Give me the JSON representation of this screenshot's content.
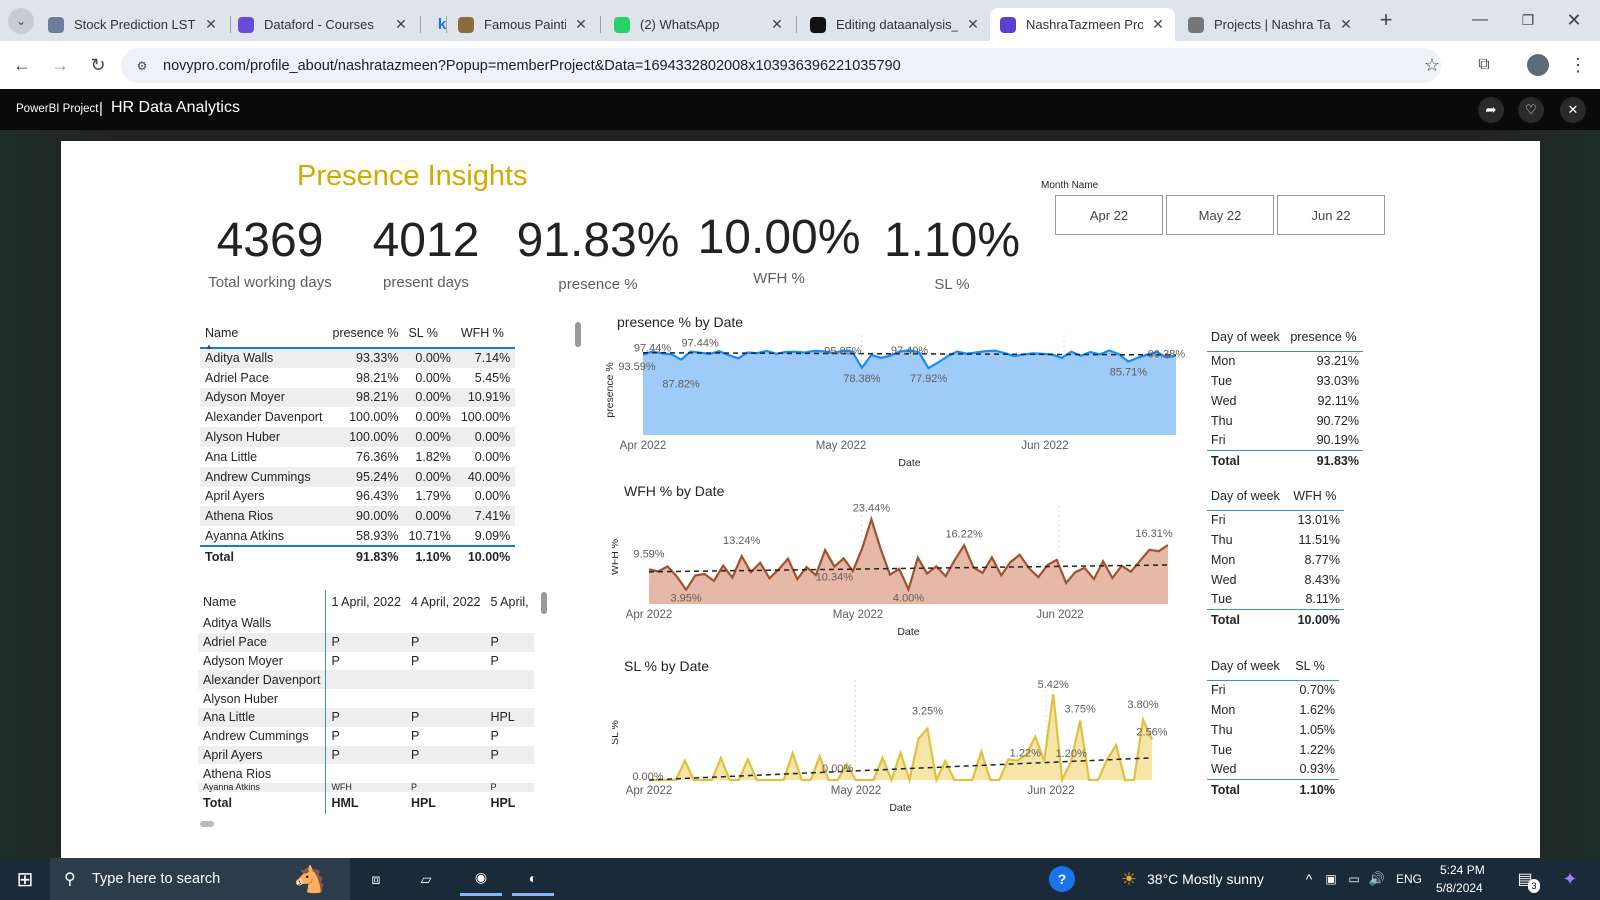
{
  "browser": {
    "tabs": [
      {
        "title": "Stock Prediction LSTM",
        "fav": "notebook-icon",
        "color": "#6b7f9a"
      },
      {
        "title": "Dataford - Courses",
        "fav": "dataford-icon",
        "color": "#6a4bd8"
      },
      {
        "title": "k",
        "fav": "k-icon",
        "color": "#1a73e8"
      },
      {
        "title": "Famous Paintings",
        "fav": "painting-icon",
        "color": "#8c6b3f"
      },
      {
        "title": "(2) WhatsApp",
        "fav": "whatsapp-icon",
        "color": "#25d366"
      },
      {
        "title": "Editing dataanalysis_",
        "fav": "github-icon",
        "color": "#111111"
      },
      {
        "title": "NashraTazmeen Proje",
        "fav": "novypro-icon",
        "color": "#5b3fd1"
      },
      {
        "title": "Projects | Nashra Taz",
        "fav": "globe-icon",
        "color": "#777777"
      }
    ],
    "new_tab": "+",
    "url": "novypro.com/profile_about/nashratazmeen?Popup=memberProject&Data=1694332802008x103936396221035790"
  },
  "header": {
    "prefix": "PowerBI Project",
    "separator": "|",
    "title": "HR Data Analytics"
  },
  "report": {
    "title": "Presence Insights",
    "kpis": [
      {
        "value": "4369",
        "label": "Total working days"
      },
      {
        "value": "4012",
        "label": "present days"
      },
      {
        "value": "91.83%",
        "label": "presence %"
      },
      {
        "value": "10.00%",
        "label": "WFH %"
      },
      {
        "value": "1.10%",
        "label": "SL %"
      }
    ],
    "month_slicer": {
      "label": "Month Name",
      "options": [
        "Apr 22",
        "May 22",
        "Jun 22"
      ]
    },
    "emp_table": {
      "headers": [
        "Name",
        "presence %",
        "SL %",
        "WFH %"
      ],
      "rows": [
        [
          "Aditya Walls",
          "93.33%",
          "0.00%",
          "7.14%"
        ],
        [
          "Adriel Pace",
          "98.21%",
          "0.00%",
          "5.45%"
        ],
        [
          "Adyson Moyer",
          "98.21%",
          "0.00%",
          "10.91%"
        ],
        [
          "Alexander Davenport",
          "100.00%",
          "0.00%",
          "100.00%"
        ],
        [
          "Alyson Huber",
          "100.00%",
          "0.00%",
          "0.00%"
        ],
        [
          "Ana Little",
          "76.36%",
          "1.82%",
          "0.00%"
        ],
        [
          "Andrew Cummings",
          "95.24%",
          "0.00%",
          "40.00%"
        ],
        [
          "April Ayers",
          "96.43%",
          "1.79%",
          "0.00%"
        ],
        [
          "Athena Rios",
          "90.00%",
          "0.00%",
          "7.41%"
        ],
        [
          "Ayanna Atkins",
          "58.93%",
          "10.71%",
          "9.09%"
        ]
      ],
      "total": [
        "Total",
        "91.83%",
        "1.10%",
        "10.00%"
      ]
    },
    "attendance_table": {
      "headers": [
        "Name",
        "1 April, 2022",
        "4 April, 2022",
        "5 April,"
      ],
      "rows": [
        [
          "Aditya Walls",
          "",
          "",
          ""
        ],
        [
          "Adriel Pace",
          "P",
          "P",
          "P"
        ],
        [
          "Adyson Moyer",
          "P",
          "P",
          "P"
        ],
        [
          "Alexander Davenport",
          "",
          "",
          ""
        ],
        [
          "Alyson Huber",
          "",
          "",
          ""
        ],
        [
          "Ana Little",
          "P",
          "P",
          "HPL"
        ],
        [
          "Andrew Cummings",
          "P",
          "P",
          "P"
        ],
        [
          "April Ayers",
          "P",
          "P",
          "P"
        ],
        [
          "Athena Rios",
          "",
          "",
          ""
        ],
        [
          "Ayanna Atkins",
          "WFH",
          "P",
          "P"
        ]
      ],
      "total": [
        "Total",
        "HML",
        "HPL",
        "HPL"
      ]
    },
    "dow_presence": {
      "headers": [
        "Day of week",
        "presence %"
      ],
      "rows": [
        [
          "Mon",
          "93.21%"
        ],
        [
          "Tue",
          "93.03%"
        ],
        [
          "Wed",
          "92.11%"
        ],
        [
          "Thu",
          "90.72%"
        ],
        [
          "Fri",
          "90.19%"
        ]
      ],
      "total": [
        "Total",
        "91.83%"
      ]
    },
    "dow_wfh": {
      "headers": [
        "Day of week",
        "WFH %"
      ],
      "rows": [
        [
          "Fri",
          "13.01%"
        ],
        [
          "Thu",
          "11.51%"
        ],
        [
          "Mon",
          "8.77%"
        ],
        [
          "Wed",
          "8.43%"
        ],
        [
          "Tue",
          "8.11%"
        ]
      ],
      "total": [
        "Total",
        "10.00%"
      ]
    },
    "dow_sl": {
      "headers": [
        "Day of week",
        "SL %"
      ],
      "rows": [
        [
          "Fri",
          "0.70%"
        ],
        [
          "Mon",
          "1.62%"
        ],
        [
          "Thu",
          "1.05%"
        ],
        [
          "Tue",
          "1.22%"
        ],
        [
          "Wed",
          "0.93%"
        ]
      ],
      "total": [
        "Total",
        "1.10%"
      ]
    },
    "charts_titles": [
      "presence % by Date",
      "WFH % by Date",
      "SL % by Date"
    ]
  },
  "chart_data": [
    {
      "type": "area",
      "title": "presence % by Date",
      "xlabel": "Date",
      "ylabel": "presence %",
      "x_ticks": [
        "Apr 2022",
        "May 2022",
        "Jun 2022"
      ],
      "color": "#118dff",
      "fill": "#9ecbf7",
      "ylim": [
        0,
        105
      ],
      "values": [
        93.59,
        97.44,
        95.2,
        94.1,
        87.82,
        97.44,
        96.0,
        94.5,
        97.8,
        93.1,
        89.5,
        96.3,
        95.6,
        98.0,
        94.7,
        96.8,
        97.2,
        96.1,
        98.1,
        97.6,
        95.85,
        98.4,
        97.1,
        78.38,
        93.5,
        90.1,
        92.6,
        97.4,
        98.9,
        96.4,
        77.92,
        84.6,
        91.8,
        97.4,
        94.8,
        96.2,
        97.9,
        98.3,
        95.6,
        92.1,
        93.9,
        95.2,
        94.7,
        93.8,
        89.9,
        97.1,
        92.4,
        96.8,
        94.0,
        98.6,
        94.3,
        85.71,
        90.2,
        93.8,
        96.7,
        90.38,
        93.0
      ],
      "data_labels": [
        "93.59%",
        "97.44%",
        "87.82%",
        "97.44%",
        "95.85%",
        "78.38%",
        "97.40%",
        "77.92%",
        "85.71%",
        "90.38%"
      ],
      "trend": [
        96.0,
        93.4
      ]
    },
    {
      "type": "area",
      "title": "WFH % by Date",
      "xlabel": "Date",
      "ylabel": "WFH %",
      "x_ticks": [
        "Apr 2022",
        "May 2022",
        "Jun 2022"
      ],
      "color": "#a0522d",
      "fill": "#e6b8a8",
      "ylim": [
        0,
        26
      ],
      "values": [
        9.59,
        9.0,
        10.4,
        7.6,
        3.95,
        7.9,
        8.3,
        6.4,
        10.6,
        7.3,
        13.24,
        8.8,
        11.4,
        7.1,
        9.6,
        12.5,
        6.9,
        10.2,
        8.0,
        14.9,
        10.34,
        12.6,
        9.1,
        15.4,
        23.44,
        15.2,
        8.1,
        9.7,
        4.0,
        12.8,
        8.4,
        10.4,
        7.7,
        12.2,
        16.22,
        10.1,
        8.6,
        12.9,
        7.9,
        11.6,
        13.6,
        9.9,
        7.4,
        10.8,
        12.2,
        5.8,
        8.8,
        10.0,
        6.9,
        11.8,
        7.2,
        10.6,
        8.9,
        12.0,
        15.0,
        14.6,
        16.31
      ],
      "data_labels": [
        "9.59%",
        "3.95%",
        "13.24%",
        "10.34%",
        "23.44%",
        "4.00%",
        "16.22%",
        "16.31%"
      ],
      "trend": [
        8.9,
        10.8
      ]
    },
    {
      "type": "area",
      "title": "SL % by Date",
      "xlabel": "Date",
      "ylabel": "SL %",
      "x_ticks": [
        "Apr 2022",
        "May 2022",
        "Jun 2022"
      ],
      "color": "#e0c03d",
      "fill": "#f5e6a8",
      "ylim": [
        0,
        6
      ],
      "values": [
        0,
        0,
        0,
        0,
        1.22,
        0,
        0,
        0,
        1.4,
        0,
        0,
        1.3,
        0,
        0,
        0,
        0,
        1.7,
        0,
        0,
        1.5,
        0,
        0,
        1.0,
        0,
        0,
        0,
        1.4,
        0,
        1.72,
        0,
        2.6,
        3.25,
        0,
        1.2,
        0,
        0,
        0,
        1.8,
        0,
        0,
        1.3,
        1.22,
        1.6,
        2.75,
        1.2,
        5.42,
        0,
        1.2,
        3.75,
        0,
        0,
        1.3,
        2.2,
        0,
        0,
        3.8,
        2.56
      ],
      "data_labels": [
        "0.00%",
        "3.25%",
        "0.00%",
        "5.42%",
        "3.75%",
        "1.22%",
        "1.20%",
        "3.80%",
        "2.56%"
      ],
      "trend": [
        0.0,
        1.4
      ]
    }
  ],
  "taskbar": {
    "search_placeholder": "Type here to search",
    "weather": "38°C  Mostly sunny",
    "lang": "ENG",
    "time": "5:24 PM",
    "date": "5/8/2024",
    "notif_count": "3"
  }
}
